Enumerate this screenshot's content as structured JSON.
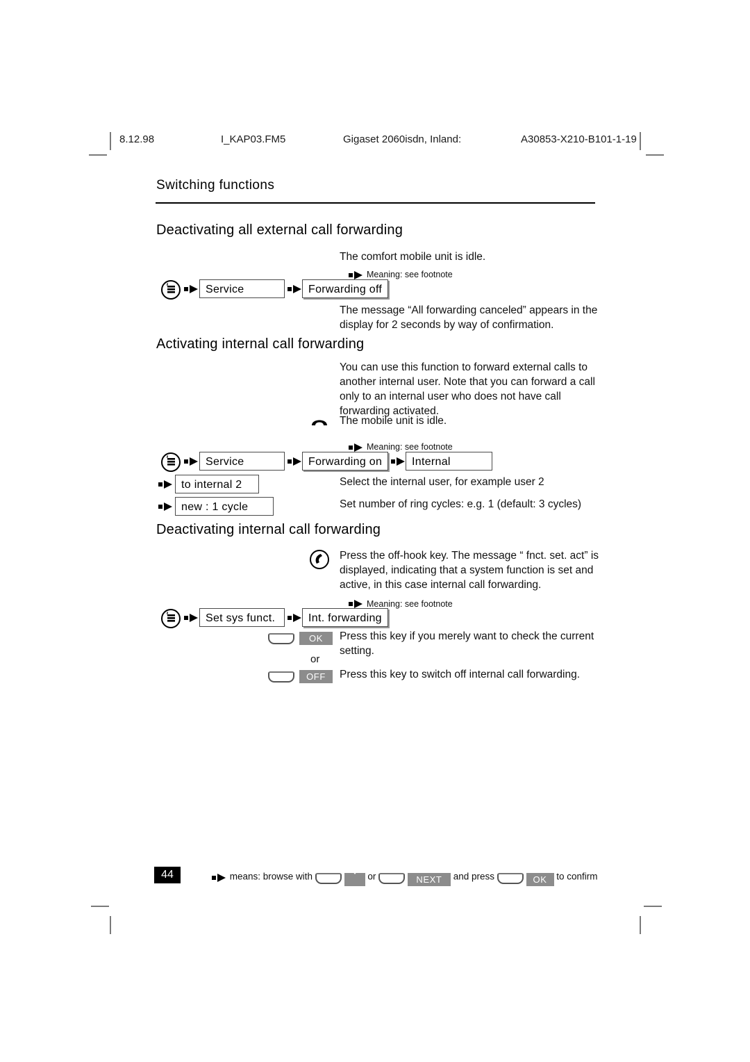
{
  "header": {
    "date": "8.12.98",
    "file": "I_KAP03.FM5",
    "product": "Gigaset 2060isdn, Inland:",
    "doc_code": "A30853-X210-B101-1-19"
  },
  "chapter_title": "Switching functions",
  "sections": [
    {
      "heading": "Deactivating all external call forwarding",
      "intro": "The comfort mobile unit is idle.",
      "footnote_label": "Meaning: see footnote",
      "steps": [
        {
          "icon": "menu-key-icon",
          "boxes": [
            "Service",
            "Forwarding off"
          ]
        }
      ],
      "outro": "The message “All forwarding canceled” appears in the display for 2 seconds by way of confirmation."
    },
    {
      "heading": "Activating internal call forwarding",
      "intro": "You can use this function to forward external calls to another internal user. Note that you can forward a call only to an internal user who does not have call forwarding activated.",
      "idle_note": "The mobile unit is idle.",
      "footnote_label": "Meaning: see footnote",
      "boxes_row1": [
        "Service",
        "Forwarding on",
        "Internal"
      ],
      "rows": [
        {
          "box": "to internal 2",
          "desc": "Select the internal user, for example user 2"
        },
        {
          "box": "new : 1 cycle",
          "desc": "Set number of ring cycles: e.g. 1 (default: 3 cycles)"
        }
      ]
    },
    {
      "heading": "Deactivating internal call forwarding",
      "intro": "Press the off-hook key. The message “ fnct. set. act” is displayed, indicating that a system function is set and active, in this case internal call forwarding.",
      "footnote_label": "Meaning: see footnote",
      "boxes_row1": [
        "Set sys funct.",
        "Int. forwarding"
      ],
      "keys": [
        {
          "badge": "OK",
          "desc": "Press this key if you merely want to check the current setting."
        },
        {
          "separator": "or"
        },
        {
          "badge": "OFF",
          "desc": "Press this key to switch off internal call forwarding."
        }
      ]
    }
  ],
  "footer": {
    "page_number": "44",
    "text_1": "means: browse with",
    "badge_down": "down-arrow-icon",
    "text_or": "or",
    "badge_next": "NEXT",
    "text_2": "and press",
    "badge_ok": "OK",
    "text_3": "to confirm"
  },
  "colors": {
    "badge_gray": "#8c8c8c",
    "rule_black": "#000000",
    "crop_mark": "#7a7a7a"
  }
}
